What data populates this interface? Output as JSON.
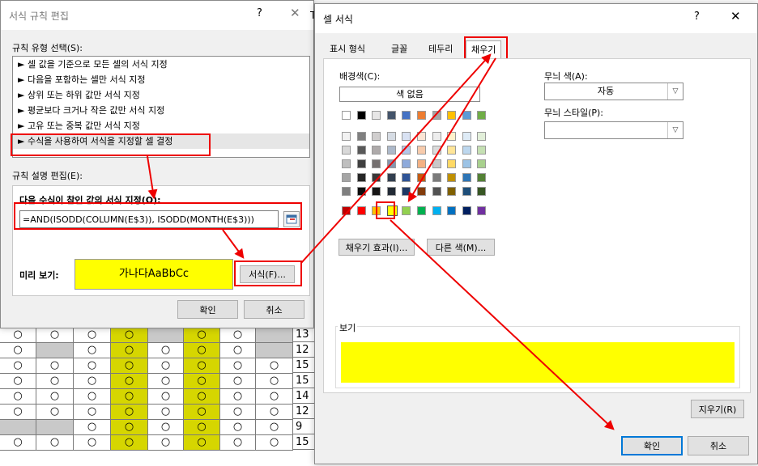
{
  "sheet": {
    "rows": [
      [
        "○",
        "○",
        "○",
        "○",
        "",
        "○",
        "○",
        "",
        "13"
      ],
      [
        "○",
        "",
        "○",
        "○",
        "○",
        "○",
        "○",
        "",
        "12"
      ],
      [
        "○",
        "○",
        "○",
        "○",
        "○",
        "○",
        "○",
        "○",
        "15"
      ],
      [
        "○",
        "○",
        "○",
        "○",
        "○",
        "○",
        "○",
        "○",
        "15"
      ],
      [
        "○",
        "○",
        "○",
        "○",
        "○",
        "○",
        "○",
        "○",
        "14"
      ],
      [
        "○",
        "○",
        "○",
        "○",
        "○",
        "○",
        "○",
        "○",
        "12"
      ],
      [
        "",
        "",
        "○",
        "○",
        "○",
        "○",
        "○",
        "○",
        "9"
      ],
      [
        "○",
        "○",
        "○",
        "○",
        "○",
        "○",
        "○",
        "○",
        "15"
      ]
    ],
    "side_label": "T"
  },
  "rule_dialog": {
    "title": "서식 규칙 편집",
    "help": "?",
    "close": "✕",
    "rule_type_label": "규칙 유형 선택(S):",
    "rule_types": [
      "► 셀 값을 기준으로 모든 셀의 서식 지정",
      "► 다음을 포함하는 셀만 서식 지정",
      "► 상위 또는 하위 값만 서식 지정",
      "► 평균보다 크거나 작은 값만 서식 지정",
      "► 고유 또는 중복 값만 서식 지정",
      "► 수식을 사용하여 서식을 지정할 셀 결정"
    ],
    "desc_label": "규칙 설명 편집(E):",
    "formula_label": "다음 수식이 참인 값의 서식 지정(O):",
    "formula": "=AND(ISODD(COLUMN(E$3)), ISODD(MONTH(E$3)))",
    "preview_label": "미리 보기:",
    "preview_text": "가나다AaBbCc",
    "format_button": "서식(F)...",
    "ok": "확인",
    "cancel": "취소"
  },
  "cell_dialog": {
    "title": "셀 서식",
    "help": "?",
    "close": "✕",
    "tabs": [
      "표시 형식",
      "글꼴",
      "테두리",
      "채우기"
    ],
    "active_tab": "채우기",
    "bg_color_label": "배경색(C):",
    "no_color": "색 없음",
    "pattern_color_label": "무늬 색(A):",
    "pattern_color_value": "자동",
    "pattern_style_label": "무늬 스타일(P):",
    "pattern_style_value": "",
    "fill_effects": "채우기 효과(I)...",
    "more_colors": "다른 색(M)...",
    "sample_label": "보기",
    "sample_color": "#FFFF00",
    "clear": "지우기(R)",
    "ok": "확인",
    "cancel": "취소",
    "theme_colors": [
      [
        "#FFFFFF",
        "#000000",
        "#E7E6E6",
        "#44546A",
        "#4472C4",
        "#ED7D31",
        "#A5A5A5",
        "#FFC000",
        "#5B9BD5",
        "#70AD47"
      ],
      [
        "#F2F2F2",
        "#808080",
        "#D0CECE",
        "#D6DCE4",
        "#D9E2F3",
        "#FBE5D5",
        "#EDEDED",
        "#FFF2CC",
        "#DEEBF6",
        "#E2EFD9"
      ],
      [
        "#D8D8D8",
        "#595959",
        "#AEAAAA",
        "#ADB9CA",
        "#B4C6E7",
        "#F7CBAC",
        "#DBDBDB",
        "#FFE598",
        "#BDD7EE",
        "#C5E0B3"
      ],
      [
        "#BFBFBF",
        "#404040",
        "#757070",
        "#8496B0",
        "#8EAADB",
        "#F4B183",
        "#C9C9C9",
        "#FFD965",
        "#9CC3E5",
        "#A8D08D"
      ],
      [
        "#A5A5A5",
        "#262626",
        "#3A3838",
        "#323F4F",
        "#2F5496",
        "#C55A11",
        "#7B7B7B",
        "#BF9000",
        "#2E75B5",
        "#538135"
      ],
      [
        "#7F7F7F",
        "#0C0C0C",
        "#171616",
        "#222A35",
        "#1F3864",
        "#833C0B",
        "#525252",
        "#7F6000",
        "#1E4E79",
        "#375623"
      ]
    ],
    "standard_colors": [
      "#C00000",
      "#FF0000",
      "#FFC000",
      "#FFFF00",
      "#92D050",
      "#00B050",
      "#00B0F0",
      "#0070C0",
      "#002060",
      "#7030A0"
    ]
  }
}
